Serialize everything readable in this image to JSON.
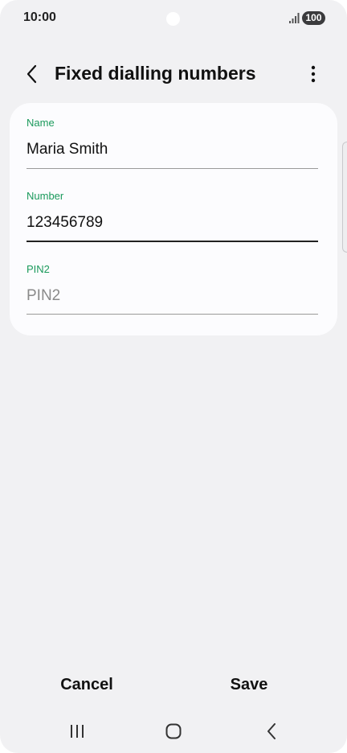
{
  "status_bar": {
    "time": "10:00",
    "battery": "100",
    "icons": [
      "signal-icon",
      "battery-icon"
    ]
  },
  "app_bar": {
    "title": "Fixed dialling numbers",
    "icons": [
      "back-arrow-icon",
      "more-vertical-icon"
    ]
  },
  "form": {
    "name": {
      "label": "Name",
      "value": "Maria Smith"
    },
    "number": {
      "label": "Number",
      "value": "123456789"
    },
    "pin2": {
      "label": "PIN2",
      "placeholder": "PIN2",
      "value": ""
    }
  },
  "actions": {
    "cancel_label": "Cancel",
    "save_label": "Save"
  },
  "nav_bar": {
    "icons": [
      "recent-apps-icon",
      "home-icon",
      "back-icon"
    ]
  },
  "colors": {
    "background": "#f1f1f3",
    "card": "#fcfcfe",
    "label_accent": "#1b9a5c",
    "active_underline": "#222222"
  }
}
